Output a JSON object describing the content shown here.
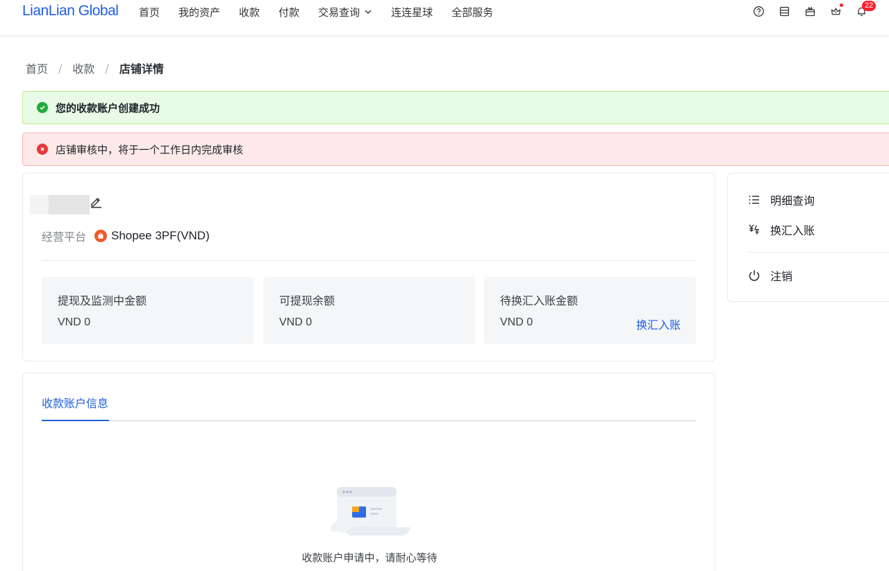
{
  "header": {
    "logo": "LianLian Global",
    "nav": [
      {
        "label": "首页"
      },
      {
        "label": "我的资产"
      },
      {
        "label": "收款"
      },
      {
        "label": "付款"
      },
      {
        "label": "交易查询",
        "dropdown": true
      },
      {
        "label": "连连星球"
      },
      {
        "label": "全部服务"
      }
    ],
    "icons": [
      "help-icon",
      "calendar-icon",
      "gift-icon",
      "crown-icon",
      "bell-icon"
    ],
    "notification_count": "22"
  },
  "breadcrumb": [
    "首页",
    "收款",
    "店铺详情"
  ],
  "alerts": {
    "success": "您的收款账户创建成功",
    "error": "店铺审核中，将于一个工作日内完成审核"
  },
  "store": {
    "platform_label": "经营平台",
    "platform_value": "Shopee 3PF(VND)",
    "stats": [
      {
        "title": "提现及监测中金额",
        "value": "VND 0"
      },
      {
        "title": "可提现余额",
        "value": "VND 0"
      },
      {
        "title": "待换汇入账金额",
        "value": "VND 0",
        "link": "换汇入账"
      }
    ]
  },
  "side_menu": {
    "items": [
      {
        "label": "明细查询",
        "icon": "list-icon"
      },
      {
        "label": "换汇入账",
        "icon": "exchange-icon"
      }
    ],
    "logout": {
      "label": "注销",
      "icon": "power-icon"
    }
  },
  "account_info": {
    "tab": "收款账户信息",
    "empty_text": "收款账户申请中，请耐心等待"
  },
  "colors": {
    "brand": "#1f5fe0",
    "success_bg": "#e8fbe6",
    "error_bg": "#fde9e8",
    "shopee": "#f05a28"
  }
}
